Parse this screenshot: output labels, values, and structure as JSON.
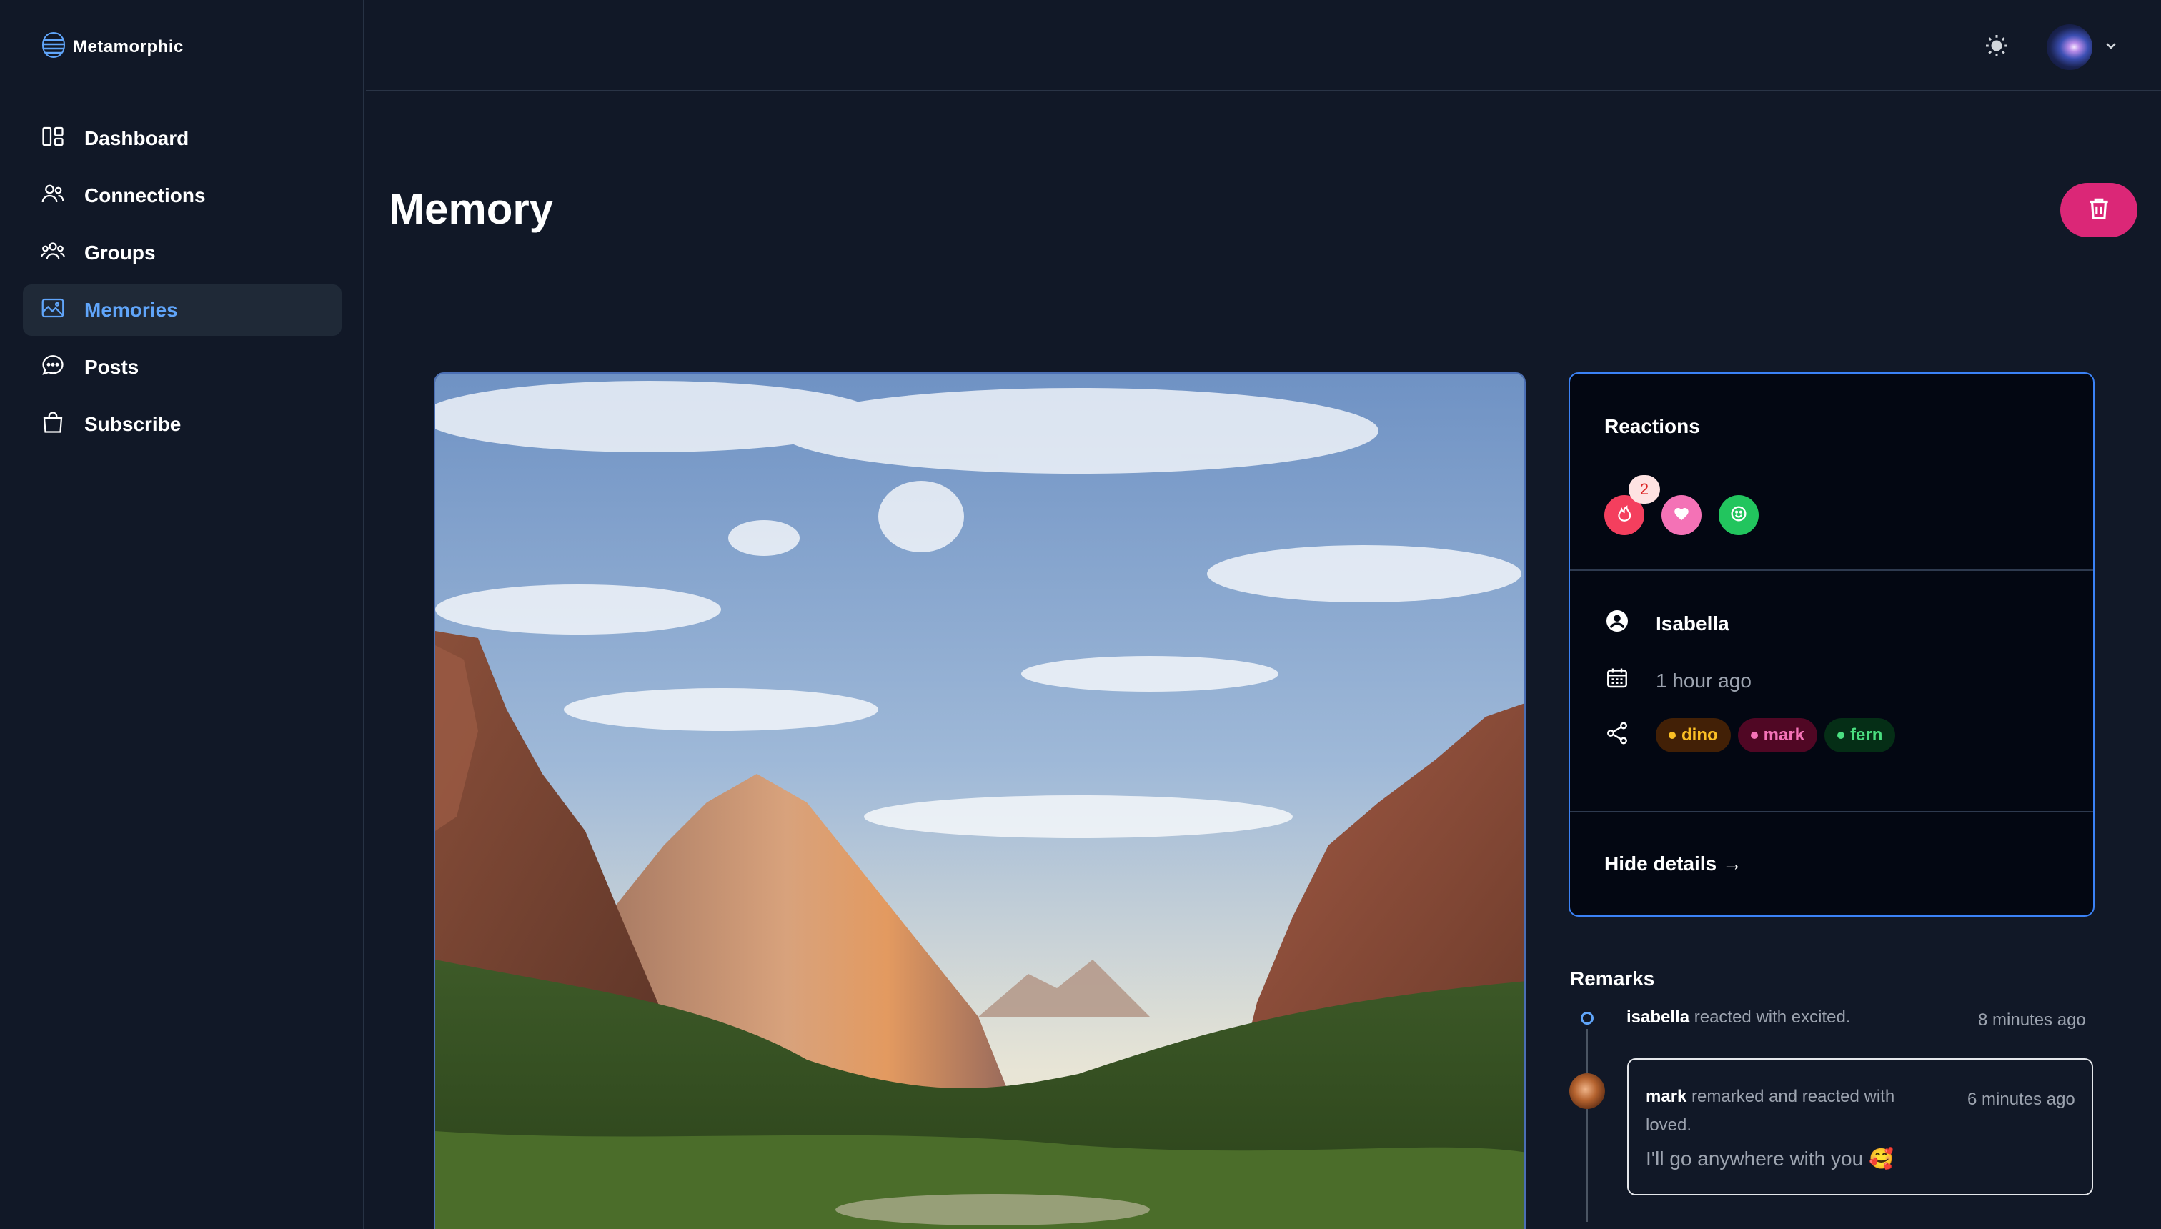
{
  "app": {
    "name": "Metamorphic"
  },
  "sidebar": {
    "items": [
      {
        "label": "Dashboard",
        "icon": "dashboard-icon"
      },
      {
        "label": "Connections",
        "icon": "users-icon"
      },
      {
        "label": "Groups",
        "icon": "user-group-icon"
      },
      {
        "label": "Memories",
        "icon": "photo-icon",
        "active": true
      },
      {
        "label": "Posts",
        "icon": "chat-bubble-icon"
      },
      {
        "label": "Subscribe",
        "icon": "shopping-bag-icon"
      }
    ]
  },
  "header": {
    "theme_icon": "sun-icon",
    "avatar_icon": "chevron-down-icon"
  },
  "page": {
    "title": "Memory",
    "delete_icon": "trash-icon"
  },
  "details": {
    "reactions_title": "Reactions",
    "reactions": [
      {
        "name": "excited",
        "icon": "fire-icon",
        "color": "#f43f5e",
        "count": "2"
      },
      {
        "name": "loved",
        "icon": "heart-icon",
        "color": "#f472b6",
        "count": ""
      },
      {
        "name": "happy",
        "icon": "smile-icon",
        "color": "#22c55e",
        "count": ""
      }
    ],
    "author": "Isabella",
    "posted": "1 hour ago",
    "shared_with": [
      {
        "name": "dino",
        "bg": "#422006",
        "fg": "#fbbf24"
      },
      {
        "name": "mark",
        "bg": "#500724",
        "fg": "#f472b6"
      },
      {
        "name": "fern",
        "bg": "#052e16",
        "fg": "#4ade80"
      }
    ],
    "hide_details": "Hide details →"
  },
  "remarks": {
    "title": "Remarks",
    "items": [
      {
        "who": "isabella",
        "text": " reacted with excited.",
        "time": "8 minutes ago"
      },
      {
        "who": "mark",
        "text": " remarked and reacted with loved.",
        "time": "6 minutes ago",
        "body": "I'll go anywhere with you 🥰"
      }
    ]
  },
  "colors": {
    "accent": "#60a5fa",
    "delete": "#db2777",
    "card_border": "#3b82f6"
  }
}
